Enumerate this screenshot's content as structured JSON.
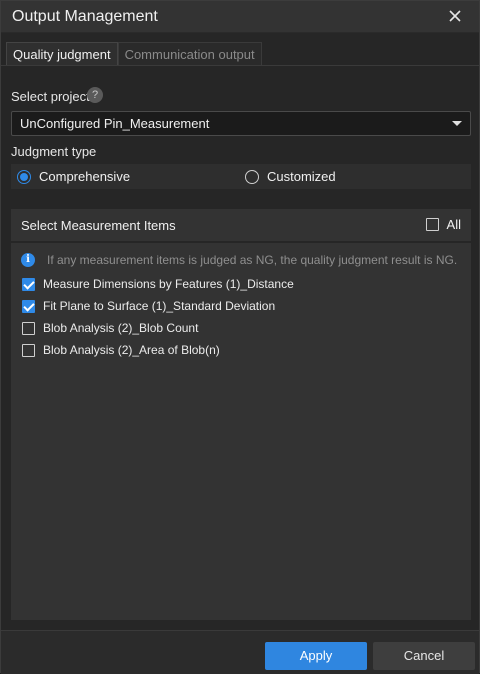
{
  "dialog": {
    "title": "Output Management"
  },
  "tabs": [
    {
      "label": "Quality judgment",
      "active": true
    },
    {
      "label": "Communication output",
      "active": false
    }
  ],
  "project": {
    "label": "Select project",
    "help": "?",
    "selected": "UnConfigured Pin_Measurement"
  },
  "judgment": {
    "label": "Judgment type",
    "options": [
      {
        "label": "Comprehensive",
        "checked": true
      },
      {
        "label": "Customized",
        "checked": false
      }
    ]
  },
  "measurement": {
    "title": "Select Measurement Items",
    "all_label": "All",
    "all_checked": false,
    "info_icon": "i",
    "info": "If any measurement items is judged as NG, the quality judgment result is NG.",
    "items": [
      {
        "label": "Measure Dimensions by Features (1)_Distance",
        "checked": true
      },
      {
        "label": "Fit Plane to Surface (1)_Standard Deviation",
        "checked": true
      },
      {
        "label": "Blob Analysis (2)_Blob Count",
        "checked": false
      },
      {
        "label": "Blob Analysis (2)_Area of Blob(n)",
        "checked": false
      }
    ]
  },
  "footer": {
    "apply_label": "Apply",
    "cancel_label": "Cancel"
  },
  "colors": {
    "accent": "#2f86e0",
    "background": "#262626",
    "panel": "#333333"
  }
}
